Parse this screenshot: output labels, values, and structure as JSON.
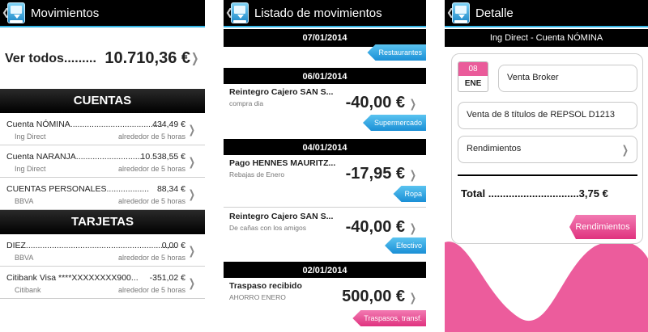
{
  "colors": {
    "accent": "#33b5e5",
    "pink": "#e0327f",
    "blue": "#1a8fd6",
    "header": "#000000"
  },
  "screens": {
    "movimientos": {
      "title": "Movimientos",
      "total_label": "Ver todos.........",
      "total_value": "10.710,36 €",
      "sections": {
        "cuentas": "CUENTAS",
        "tarjetas": "TARJETAS"
      },
      "cuentas": [
        {
          "name": "Cuenta NÓMINA.......................................",
          "value": "434,49 €",
          "bank": "Ing Direct",
          "time": "alrededor de 5 horas"
        },
        {
          "name": "Cuenta NARANJA.............................",
          "value": "10.538,55 €",
          "bank": "Ing Direct",
          "time": "alrededor de 5 horas"
        },
        {
          "name": "CUENTAS PERSONALES..................",
          "value": "88,34 €",
          "bank": "BBVA",
          "time": "alrededor de 5 horas"
        }
      ],
      "tarjetas": [
        {
          "name": "DIEZ................................................................",
          "value": "0,00 €",
          "bank": "BBVA",
          "time": "alrededor de 5 horas"
        },
        {
          "name": "Citibank Visa ****XXXXXXXX900...",
          "value": "-351,02 €",
          "bank": "Citibank",
          "time": "alrededor de 5 horas"
        }
      ]
    },
    "listado": {
      "title": "Listado de movimientos",
      "dates": [
        "07/01/2014",
        "06/01/2014",
        "04/01/2014",
        "02/01/2014"
      ],
      "tags": [
        "Restaurantes",
        "Supermercado",
        "Ropa",
        "Efectivo",
        "Traspasos, transf."
      ],
      "movements": [
        {
          "concept": "Reintegro Cajero SAN S...",
          "note": "compra dia",
          "amount": "-40,00 €"
        },
        {
          "concept": "Pago HENNES MAURITZ...",
          "note": "Rebajas de Enero",
          "amount": "-17,95 €"
        },
        {
          "concept": "Reintegro Cajero SAN S...",
          "note": "De cañas con los amigos",
          "amount": "-40,00 €"
        },
        {
          "concept": "Traspaso recibido",
          "note": "AHORRO ENERO",
          "amount": "500,00 €"
        }
      ]
    },
    "detalle": {
      "title": "Detalle",
      "account": "Ing Direct - Cuenta NÓMINA",
      "day": "08",
      "month": "ENE",
      "name_field": "Venta Broker",
      "desc_field": "Venta de 8 títulos de REPSOL D1213",
      "category_field": "Rendimientos",
      "total_label": "Total ...............................3,75 €",
      "button": "Rendimientos"
    }
  }
}
